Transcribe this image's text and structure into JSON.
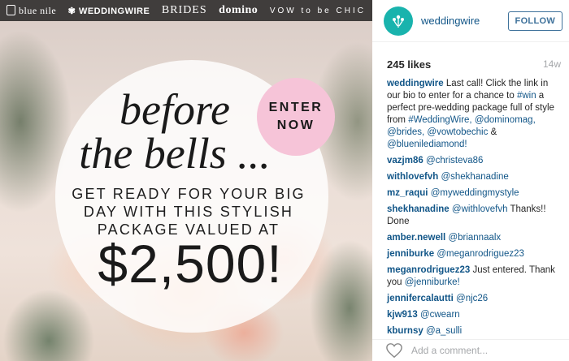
{
  "banner": {
    "brands": [
      "blue nile",
      "WEDDINGWIRE",
      "BRIDES",
      "domino",
      "VOW to be CHIC"
    ]
  },
  "image": {
    "headline": [
      "before",
      "the bells ..."
    ],
    "subhead": [
      "GET READY FOR YOUR BIG",
      "DAY WITH THIS STYLISH",
      "PACKAGE VALUED AT"
    ],
    "amount": "$2,500!",
    "cta": [
      "ENTER",
      "NOW"
    ],
    "cta_color": "#f6c4d8"
  },
  "post": {
    "username": "weddingwire",
    "follow_label": "FOLLOW",
    "likes": "245 likes",
    "age": "14w",
    "avatar_color": "#19b3ad",
    "caption_user": "weddingwire",
    "caption_text": "Last call! Click the link in our bio to enter for a chance to #win a perfect pre-wedding package full of style from #WeddingWire, @dominomag, @brides, @vowtobechic & @bluenilediamond!",
    "add_comment_placeholder": "Add a comment..."
  },
  "comments": [
    {
      "user": "vazjm86",
      "text": "@christeva86"
    },
    {
      "user": "withlovefvh",
      "text": "@shekhanadine"
    },
    {
      "user": "mz_raqui",
      "text": "@myweddingmystyle"
    },
    {
      "user": "shekhanadine",
      "text": "@withlovefvh Thanks!! Done"
    },
    {
      "user": "amber.newell",
      "text": "@briannaalx"
    },
    {
      "user": "jenniburke",
      "text": "@meganrodriguez23"
    },
    {
      "user": "meganrodriguez23",
      "text": "Just entered. Thank you @jenniburke!"
    },
    {
      "user": "jennifercalautti",
      "text": "@njc26"
    },
    {
      "user": "kjw913",
      "text": "@cwearn"
    },
    {
      "user": "kburnsy",
      "text": "@a_sulli"
    }
  ]
}
